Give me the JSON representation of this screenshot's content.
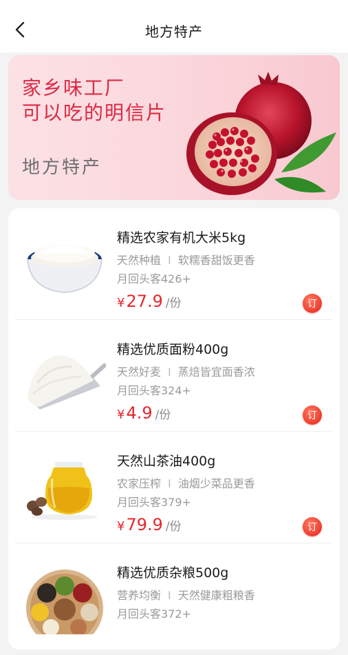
{
  "header": {
    "title": "地方特产"
  },
  "banner": {
    "line1": "家乡味工厂",
    "line2": "可以吃的明信片",
    "subtitle": "地方特产"
  },
  "products": [
    {
      "name": "精选农家有机大米5kg",
      "tag1": "天然种植",
      "tag2": "软糯香甜饭更香",
      "sales": "月回头客426+",
      "currency": "¥",
      "price": "27.9",
      "unit": "/份",
      "order_label": "订",
      "image_icon": "rice-bowl-icon"
    },
    {
      "name": "精选优质面粉400g",
      "tag1": "天然好麦",
      "tag2": "蒸焙皆宜面香浓",
      "sales": "月回头客324+",
      "currency": "¥",
      "price": "4.9",
      "unit": "/份",
      "order_label": "订",
      "image_icon": "flour-scoop-icon"
    },
    {
      "name": "天然山茶油400g",
      "tag1": "农家压榨",
      "tag2": "油烟少菜品更香",
      "sales": "月回头客379+",
      "currency": "¥",
      "price": "79.9",
      "unit": "/份",
      "order_label": "订",
      "image_icon": "oil-jar-icon"
    },
    {
      "name": "精选优质杂粮500g",
      "tag1": "营养均衡",
      "tag2": "天然健康粗粮香",
      "sales": "月回头客372+",
      "currency": "¥",
      "price": "",
      "unit": "",
      "order_label": "",
      "image_icon": "grains-plate-icon"
    }
  ],
  "tag_separator": "I",
  "colors": {
    "accent": "#e6262c",
    "banner_text": "#dc2a44",
    "background": "#f3f3f3"
  }
}
